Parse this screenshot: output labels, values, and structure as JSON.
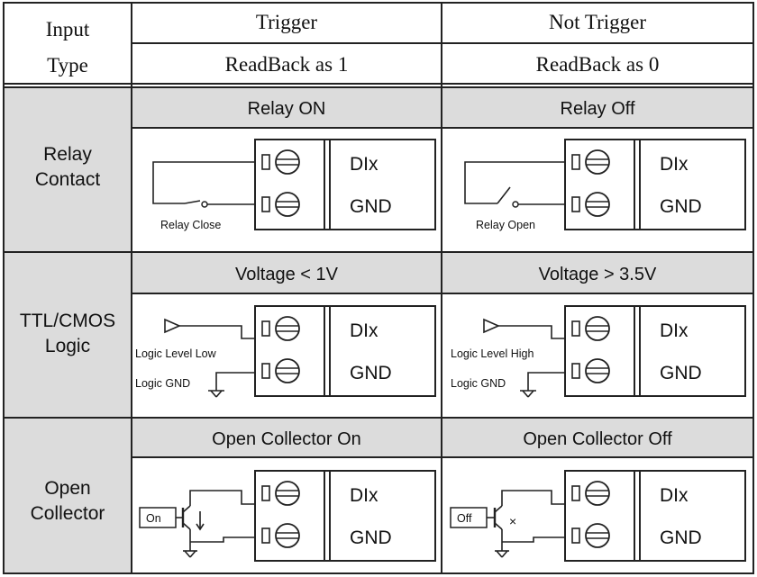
{
  "header": {
    "input_type_line1": "Input",
    "input_type_line2": "Type",
    "trigger": "Trigger",
    "not_trigger": "Not Trigger",
    "readback_1": "ReadBack as 1",
    "readback_0": "ReadBack as 0"
  },
  "rows": [
    {
      "label_line1": "Relay",
      "label_line2": "Contact",
      "trigger_title": "Relay ON",
      "not_trigger_title": "Relay Off",
      "trigger_caption": "Relay Close",
      "not_trigger_caption": "Relay Open"
    },
    {
      "label_line1": "TTL/CMOS",
      "label_line2": "Logic",
      "trigger_title": "Voltage < 1V",
      "not_trigger_title": "Voltage > 3.5V",
      "trigger_caption": "Logic Level Low",
      "not_trigger_caption": "Logic Level High",
      "gnd_caption": "Logic GND"
    },
    {
      "label_line1": "Open",
      "label_line2": "Collector",
      "trigger_title": "Open Collector On",
      "not_trigger_title": "Open Collector Off",
      "trigger_caption": "On",
      "not_trigger_caption": "Off",
      "off_mark": "×"
    }
  ],
  "terminals": {
    "dix": "DIx",
    "gnd": "GND"
  },
  "colors": {
    "shade": "#dcdcdc",
    "line": "#222222"
  }
}
